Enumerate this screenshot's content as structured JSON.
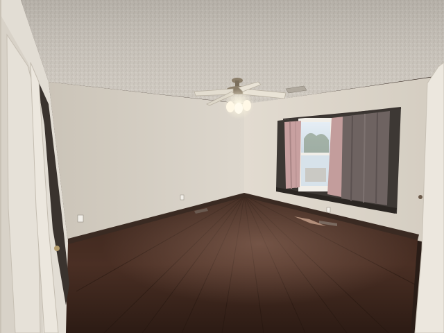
{
  "scene": {
    "kind": "photo",
    "subject": "empty-bedroom",
    "colors": {
      "ceiling": "#cfc9c0",
      "left_wall": "#d6d0c6",
      "right_wall": "#ddd6cb",
      "floor_dark": "#2a1a14",
      "floor_mid": "#4a3025",
      "floor_light": "#6b4a3a",
      "curtain_pink": "#c8a0a0",
      "curtain_gray": "#6e6361",
      "window_sky": "#dfe8f0",
      "door": "#e2ddd4",
      "baseboard": "#3a2a22",
      "fan_blade": "#e9e3d6",
      "fan_metal": "#8b7e6a",
      "light_glow": "#fff6dc"
    },
    "icons": [
      "ceiling-fan",
      "window",
      "door",
      "outlet",
      "floor-vent",
      "ceiling-vent"
    ]
  }
}
